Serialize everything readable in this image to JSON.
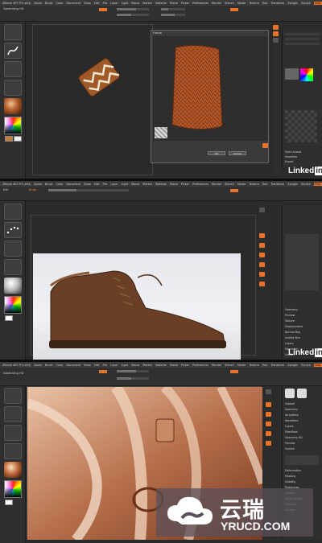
{
  "brand": {
    "accent": "#e8742b",
    "bg": "#2b2b2b"
  },
  "panel1": {
    "menu": [
      "ZBrush 4R7 P3 (x64)",
      "Alpha",
      "Brush",
      "Color",
      "Document",
      "Draw",
      "Edit",
      "File",
      "Layer",
      "Light",
      "Macro",
      "Marker",
      "Material",
      "Movie",
      "Picker",
      "Preferences",
      "Render",
      "Stencil",
      "Stroke",
      "Texture",
      "Tool",
      "Transform",
      "Zplugin",
      "Zscript"
    ],
    "menu_accent": "Help",
    "subtool_label": "Subdividing HD",
    "dialog_title": "Frame",
    "dialog_ok": "OK",
    "dialog_cancel": "Cancel",
    "right_items": [
      "Hide Unused",
      "Seamless",
      "Export"
    ],
    "linkedin": "Linked"
  },
  "panel2": {
    "toolbar_left": "Edit",
    "toolbar_brush": "Brush",
    "right_items": [
      "Geometry",
      "Preview",
      "Texture",
      "Displacement",
      "Normal Map",
      "Unified Skin",
      "Layers",
      "Fibermesh",
      "Surface"
    ],
    "linkedin": "Linked"
  },
  "panel3": {
    "subtool_label": "Subdividing HD",
    "right_items": [
      "Subtool",
      "Geometry",
      "ArrayMesh",
      "NanoMesh",
      "Layers",
      "FiberMesh",
      "Geometry HD",
      "Preview",
      "Surface",
      "Deformation",
      "Masking",
      "Visibility",
      "Polygroups",
      "Contact",
      "Morph Target",
      "Polypaint",
      "UV Map"
    ]
  },
  "watermark": {
    "title": "云瑞",
    "subtitle": "YRUCD.COM"
  },
  "icons": [
    "cloud-icon",
    "brush-icon",
    "sphere-icon",
    "color-picker-icon"
  ]
}
